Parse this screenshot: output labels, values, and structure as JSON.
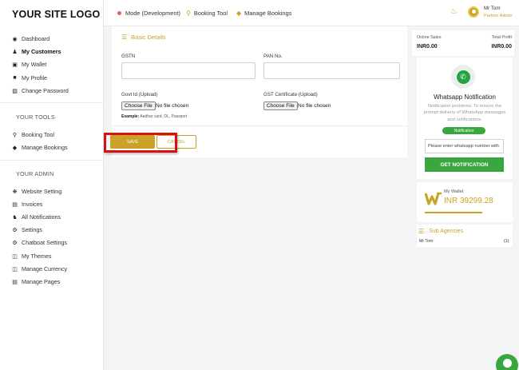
{
  "sidebar": {
    "logo": "YOUR SITE LOGO",
    "main_items": [
      {
        "label": "Dashboard",
        "icon": "dashboard-icon"
      },
      {
        "label": "My Customers",
        "icon": "user-icon"
      },
      {
        "label": "My Wallet",
        "icon": "wallet-icon"
      },
      {
        "label": "My Profile",
        "icon": "profile-icon"
      },
      {
        "label": "Change Password",
        "icon": "lock-icon"
      }
    ],
    "tools_heading": "YOUR TOOLS",
    "tools_items": [
      {
        "label": "Booking Tool",
        "icon": "search-icon"
      },
      {
        "label": "Manage Bookings",
        "icon": "tag-icon"
      }
    ],
    "admin_heading": "YOUR ADMIN",
    "admin_items": [
      {
        "label": "Website Setting",
        "icon": "gears-icon"
      },
      {
        "label": "Invoices",
        "icon": "invoice-icon"
      },
      {
        "label": "All Notifications",
        "icon": "people-icon"
      },
      {
        "label": "Settings",
        "icon": "gear-icon"
      },
      {
        "label": "Chatboat Settings",
        "icon": "gear-icon"
      },
      {
        "label": "My Themes",
        "icon": "document-icon"
      },
      {
        "label": "Manage Currency",
        "icon": "document-icon"
      },
      {
        "label": "Manage Pages",
        "icon": "page-icon"
      }
    ]
  },
  "topbar": {
    "mode": "Mode (Development)",
    "booking_tool": "Booking Tool",
    "manage_bookings": "Manage Bookings",
    "user_name": "Mr Tom",
    "user_role": "Partner Admin"
  },
  "form": {
    "title": "Basic Details",
    "gstn_label": "GSTN",
    "gstn_value": "",
    "pan_label": "PAN No.",
    "pan_value": "",
    "govt_id_label": "Govt Id (Upload)",
    "gst_cert_label": "GST Certificate (Upload)",
    "choose_file": "Choose File",
    "no_file": "No file chosen",
    "hint_bold": "Example:",
    "hint_text": " Aadhar card, DL, Passport",
    "save_label": "SAVE",
    "cancel_label": "CANCEL"
  },
  "stats": {
    "online_sales_label": "Online Sales",
    "online_sales_value": "INR0.00",
    "total_profit_label": "Total Profit",
    "total_profit_value": "INR0.00"
  },
  "whatsapp": {
    "title": "Whatsapp Notification",
    "description": "Notification problems. To ensure the prompt delivery of WhatsApp messages and notifications.",
    "badge": "Notification",
    "input_placeholder": "Please enter whatsapp number with",
    "button_label": "GET NOTIFICATION"
  },
  "wallet": {
    "label": "My Wallet",
    "value": "INR 39299.28"
  },
  "sub_agencies": {
    "title": "Sub Agencies",
    "rows": [
      {
        "name": "Mr Tom",
        "count": "(1)"
      }
    ]
  },
  "colors": {
    "accent": "#c9a227",
    "green": "#3aa640",
    "highlight": "#d41212"
  }
}
